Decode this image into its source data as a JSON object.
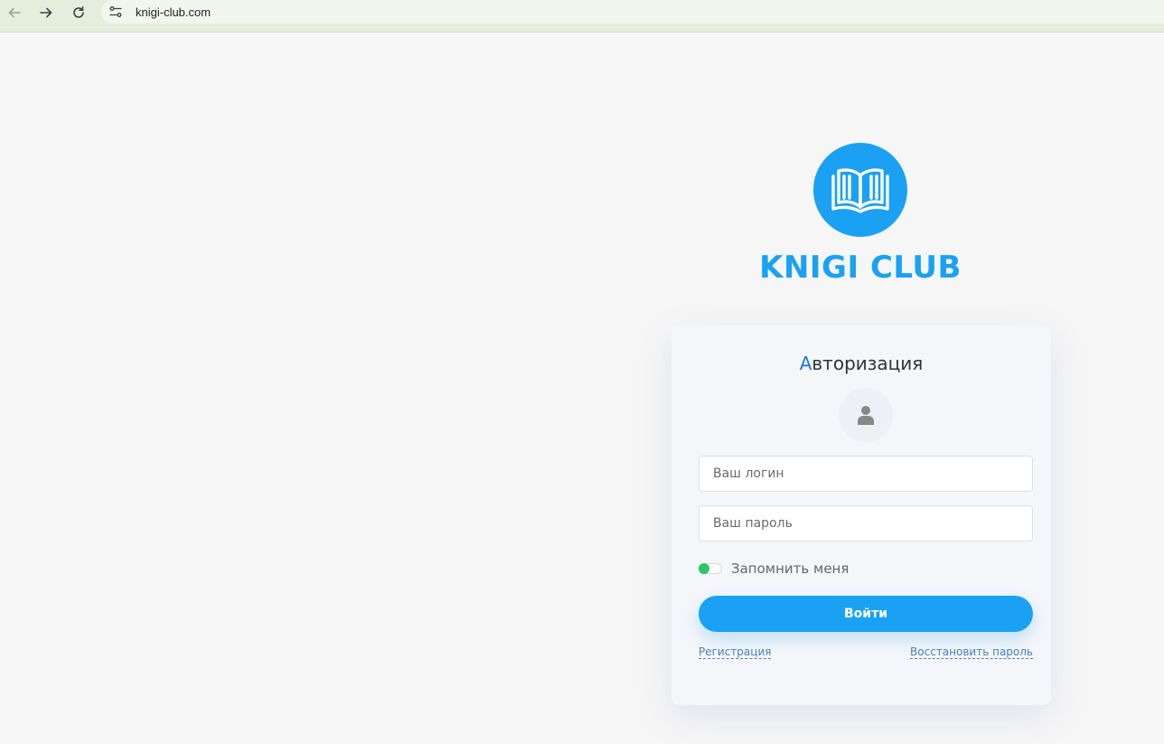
{
  "browser": {
    "url": "knigi-club.com",
    "icons": [
      "back-arrow-icon",
      "forward-arrow-icon",
      "reload-icon",
      "site-settings-icon"
    ]
  },
  "logo": {
    "brand_name": "KNIGI CLUB",
    "icon": "open-book-icon",
    "color": "#1aa1f4"
  },
  "login_form": {
    "title_first_letter": "А",
    "title_rest": "вторизация",
    "avatar_icon": "user-icon",
    "login_placeholder": "Ваш логин",
    "password_placeholder": "Ваш пароль",
    "remember_label": "Запомнить меня",
    "remember_checked": true,
    "submit_label": "Войти",
    "register_link": "Регистрация",
    "restore_link": "Восстановить пароль"
  },
  "colors": {
    "accent": "#1aa1f4",
    "title_accent": "#1a73e8",
    "toggle_on": "#2ac769"
  }
}
